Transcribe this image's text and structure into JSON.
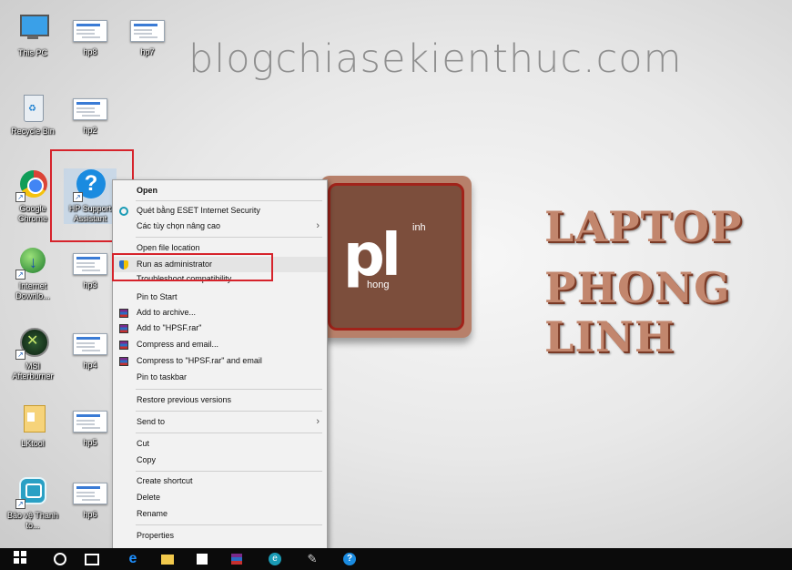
{
  "watermark": "blogchiasekienthuc.com",
  "desktop_icons": [
    {
      "label": "This PC"
    },
    {
      "label": "hp8"
    },
    {
      "label": "hp7"
    },
    {
      "label": "Recycle Bin"
    },
    {
      "label": "hp2"
    },
    {
      "label": "Google Chrome"
    },
    {
      "label": "HP Support Assistant"
    },
    {
      "label": "Internet Downlo..."
    },
    {
      "label": "hp3"
    },
    {
      "label": "MSI Afterburner"
    },
    {
      "label": "hp4"
    },
    {
      "label": "LKtool"
    },
    {
      "label": "hp5"
    },
    {
      "label": "Bảo vệ Thanh to..."
    },
    {
      "label": "hp6"
    }
  ],
  "logo": {
    "main": "pl",
    "sup": "inh",
    "sub": "hong"
  },
  "brand": {
    "line1": "LAPTOP",
    "line2": "PHONG LINH"
  },
  "context_menu": {
    "items": [
      {
        "label": "Open",
        "bold": true
      },
      {
        "label": "Quét bằng ESET Internet Security",
        "icon": "eset-icon"
      },
      {
        "label": "Các tùy chọn nâng cao",
        "submenu": true
      },
      {
        "label": "Open file location"
      },
      {
        "label": "Run as administrator",
        "icon": "uac-shield-icon",
        "highlighted": true
      },
      {
        "label": "Troubleshoot compatibility"
      },
      {
        "label": "Pin to Start"
      },
      {
        "label": "Add to archive...",
        "icon": "winrar-icon"
      },
      {
        "label": "Add to \"HPSF.rar\"",
        "icon": "winrar-icon"
      },
      {
        "label": "Compress and email...",
        "icon": "winrar-icon"
      },
      {
        "label": "Compress to \"HPSF.rar\" and email",
        "icon": "winrar-icon"
      },
      {
        "label": "Pin to taskbar"
      },
      {
        "label": "Restore previous versions"
      },
      {
        "label": "Send to",
        "submenu": true
      },
      {
        "label": "Cut"
      },
      {
        "label": "Copy"
      },
      {
        "label": "Create shortcut"
      },
      {
        "label": "Delete"
      },
      {
        "label": "Rename"
      },
      {
        "label": "Properties"
      }
    ],
    "submenu_arrow": "›"
  },
  "taskbar": {
    "icons": [
      "windows-start-icon",
      "cortana-search-icon",
      "task-view-icon",
      "edge-icon",
      "file-explorer-icon",
      "store-icon",
      "winrar-icon",
      "eset-icon",
      "tool-icon",
      "help-icon"
    ]
  },
  "colors": {
    "highlight_box": "#d6232b",
    "brand": "#c2866d",
    "taskbar": "#0b0b0b"
  }
}
